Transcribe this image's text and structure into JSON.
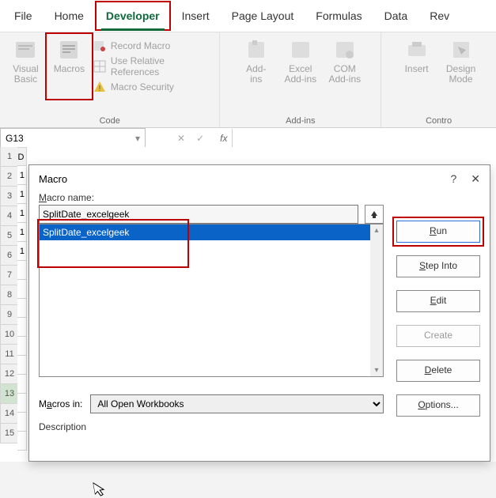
{
  "ribbon": {
    "tabs": [
      "File",
      "Home",
      "Developer",
      "Insert",
      "Page Layout",
      "Formulas",
      "Data",
      "Rev"
    ],
    "active_index": 2,
    "groups": {
      "code": {
        "label": "Code",
        "visual_basic": "Visual\nBasic",
        "macros": "Macros",
        "record_macro": "Record Macro",
        "use_relative": "Use Relative References",
        "macro_security": "Macro Security"
      },
      "addins": {
        "label": "Add-ins",
        "addins": "Add-\nins",
        "excel_addins": "Excel\nAdd-ins",
        "com_addins": "COM\nAdd-ins"
      },
      "controls": {
        "label": "Contro",
        "insert": "Insert",
        "design_mode": "Design\nMode"
      }
    }
  },
  "formula_bar": {
    "name_box": "G13",
    "fx": "fx"
  },
  "sheet": {
    "row_headers": [
      1,
      2,
      3,
      4,
      5,
      6,
      7,
      8,
      9,
      10,
      11,
      12,
      13,
      14,
      15
    ],
    "selected_row": 13,
    "colD_header": "D",
    "colD_visible_values": [
      "1",
      "1",
      "1",
      "1",
      "1",
      "",
      "",
      "",
      "",
      "",
      "",
      "",
      "",
      "",
      ""
    ]
  },
  "dialog": {
    "title": "Macro",
    "help": "?",
    "close": "✕",
    "name_label": "Macro name:",
    "macro_input_value": "SplitDate_excelgeek",
    "macro_list": [
      "SplitDate_excelgeek"
    ],
    "selected_index": 0,
    "buttons": {
      "run": "Run",
      "step_into": "Step Into",
      "edit": "Edit",
      "create": "Create",
      "delete": "Delete",
      "options": "Options..."
    },
    "macros_in_label": "Macros in:",
    "macros_in_value": "All Open Workbooks",
    "description_label": "Description"
  }
}
